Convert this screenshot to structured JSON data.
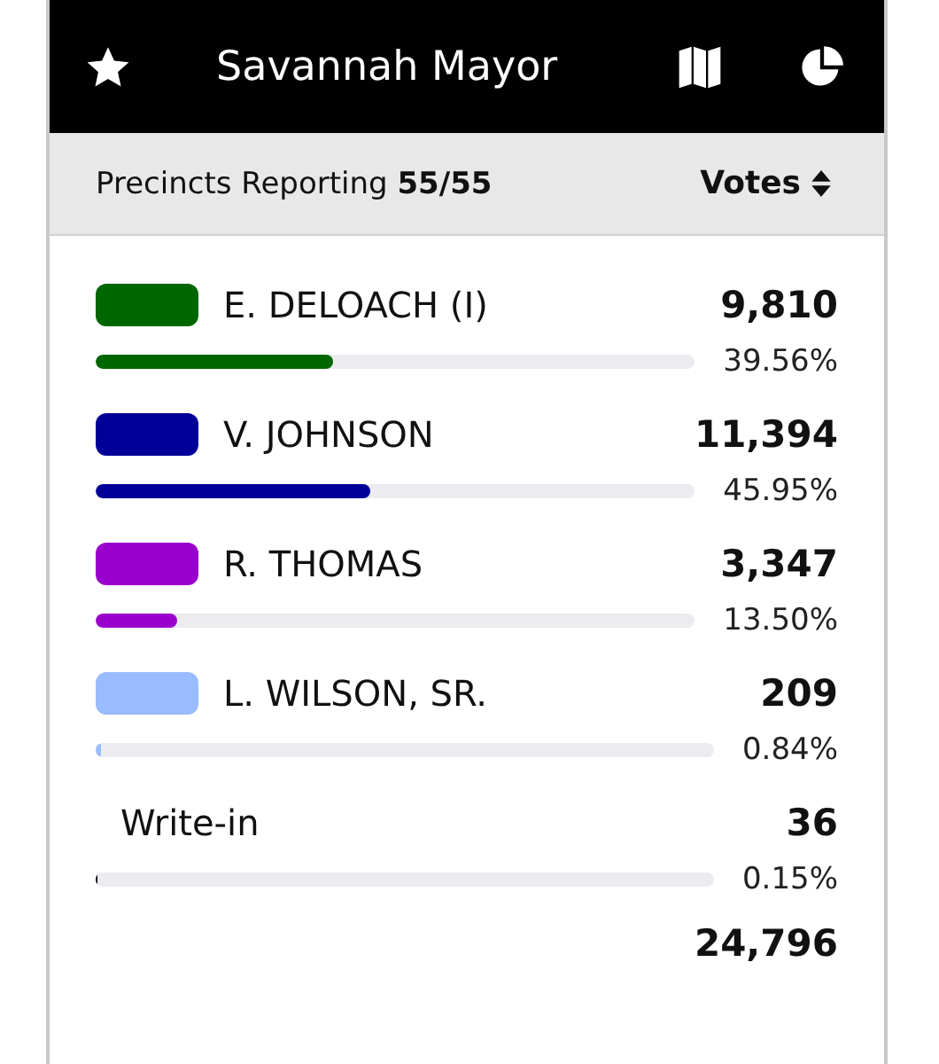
{
  "header": {
    "title": "Savannah Mayor"
  },
  "subheader": {
    "label": "Precincts Reporting",
    "value": "55/55",
    "sort": "Votes"
  },
  "candidates": [
    {
      "kind": "candidate",
      "name": "E. DELOACH (I)",
      "votes": "9,810",
      "percent": "39.56%",
      "level": 0.3956,
      "color": "#006600"
    },
    {
      "kind": "candidate",
      "name": "V. JOHNSON",
      "votes": "11,394",
      "percent": "45.95%",
      "level": 0.4595,
      "color": "#000099"
    },
    {
      "kind": "candidate",
      "name": "R. THOMAS",
      "votes": "3,347",
      "percent": "13.50%",
      "level": 0.135,
      "color": "#9900cc"
    },
    {
      "kind": "candidate",
      "name": "L. WILSON, SR.",
      "votes": "209",
      "percent": "0.84%",
      "level": 0.0084,
      "color": "#99bbff"
    },
    {
      "kind": "writein",
      "name": "Write-in",
      "votes": "36",
      "percent": "0.15%",
      "level": 0.0015,
      "color": "#000000"
    }
  ],
  "total": "24,796"
}
